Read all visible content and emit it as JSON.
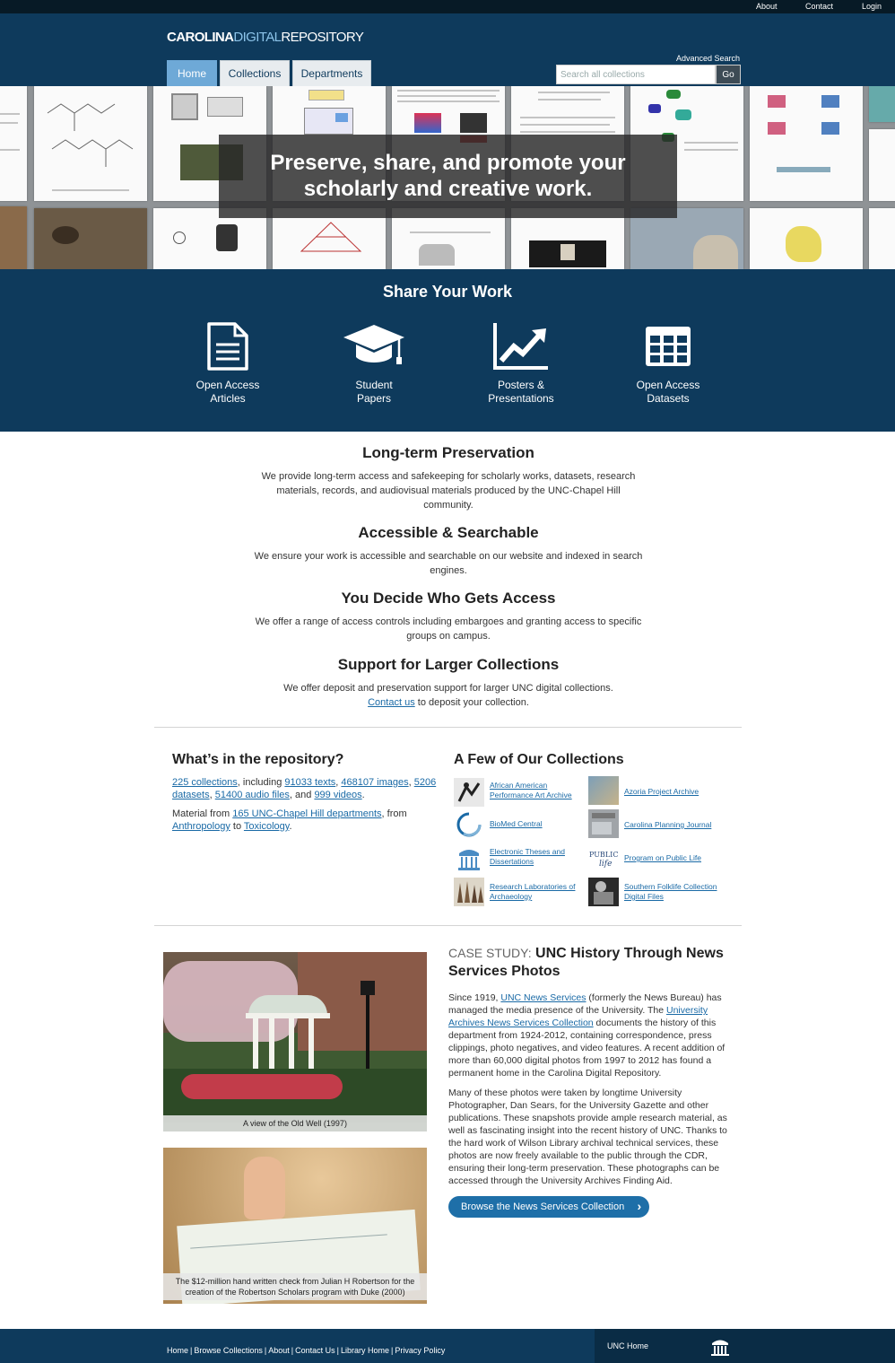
{
  "topbar": {
    "about": "About",
    "contact": "Contact",
    "login": "Login"
  },
  "header": {
    "logo_a": "CAROLINA",
    "logo_b": "DIGITAL",
    "logo_c": "REPOSITORY",
    "tabs": [
      {
        "label": "Home",
        "active": true
      },
      {
        "label": "Collections",
        "active": false
      },
      {
        "label": "Departments",
        "active": false
      }
    ],
    "advanced_search": "Advanced Search",
    "search_placeholder": "Search all collections",
    "search_button": "Go"
  },
  "hero": {
    "line1": "Preserve, share, and promote your",
    "line2": "scholarly and creative work."
  },
  "share": {
    "title": "Share Your Work",
    "items": [
      {
        "line1": "Open Access",
        "line2": "Articles",
        "icon": "document-icon"
      },
      {
        "line1": "Student",
        "line2": "Papers",
        "icon": "graduation-cap-icon"
      },
      {
        "line1": "Posters &",
        "line2": "Presentations",
        "icon": "line-chart-icon"
      },
      {
        "line1": "Open Access",
        "line2": "Datasets",
        "icon": "table-grid-icon"
      }
    ]
  },
  "info": [
    {
      "title": "Long-term Preservation",
      "text": "We provide long-term access and safekeeping for scholarly works, datasets, research materials, records, and audiovisual materials produced by the UNC-Chapel Hill community."
    },
    {
      "title": "Accessible & Searchable",
      "text": "We ensure your work is accessible and searchable on our website and indexed in search engines."
    },
    {
      "title": "You Decide Who Gets Access",
      "text": "We offer a range of access controls including embargoes and granting access to specific groups on campus."
    },
    {
      "title": "Support for Larger Collections",
      "text": "We offer deposit and preservation support for larger UNC digital collections.",
      "link": "Contact us",
      "after": " to deposit your collection."
    }
  ],
  "stats": {
    "title": "What’s in the repository?",
    "collections": "225 collections",
    "including": ", including ",
    "texts": "91033 texts",
    "images": "468107 images",
    "datasets": "5206 datasets",
    "audio": "51400 audio files",
    "and": ", and ",
    "videos": "999 videos",
    "period": ".",
    "comma": ", ",
    "material_from": "Material from ",
    "departments": "165 UNC-Chapel Hill departments",
    "from": ", from ",
    "anthropology": "Anthropology",
    "to": " to ",
    "toxicology": "Toxicology"
  },
  "collections": {
    "title": "A Few of Our Collections",
    "items": [
      {
        "name": "African American Performance Art Archive"
      },
      {
        "name": "Azoria Project Archive"
      },
      {
        "name": "BioMed Central"
      },
      {
        "name": "Carolina Planning Journal"
      },
      {
        "name": "Electronic Theses and Dissertations"
      },
      {
        "name": "Program on Public Life"
      },
      {
        "name": "Research Laboratories of Archaeology"
      },
      {
        "name": "Southern Folklife Collection Digital Files"
      }
    ]
  },
  "case_study": {
    "prefix": "CASE STUDY:",
    "title": "UNC History Through News Services Photos",
    "p1_a": "Since 1919, ",
    "p1_link1": "UNC News Services",
    "p1_b": " (formerly the News Bureau) has managed the media presence of the University. The ",
    "p1_link2": "University Archives News Services Collection",
    "p1_c": " documents the history of this department from 1924-2012, containing correspondence, press clippings, photo negatives, and video features. A recent addition of more than 60,000 digital photos from 1997 to 2012 has found a permanent home in the Carolina Digital Repository.",
    "p2": "Many of these photos were taken by longtime University Photographer, Dan Sears, for the University Gazette and other publications. These snapshots provide ample research material, as well as fascinating insight into the recent history of UNC. Thanks to the hard work of Wilson Library archival technical services, these photos are now freely available to the public through the CDR, ensuring their long-term preservation. These photographs can be accessed through the University Archives Finding Aid.",
    "button": "Browse the News Services Collection",
    "caption1": "A view of the Old Well (1997)",
    "caption2": "The $12-million hand written check from Julian H Robertson for the creation of the Robertson Scholars program with Duke (2000)"
  },
  "footer": {
    "links": [
      "Home",
      "Browse Collections",
      "About",
      "Contact Us",
      "Library Home",
      "Privacy Policy"
    ],
    "unc_home": "UNC Home"
  }
}
